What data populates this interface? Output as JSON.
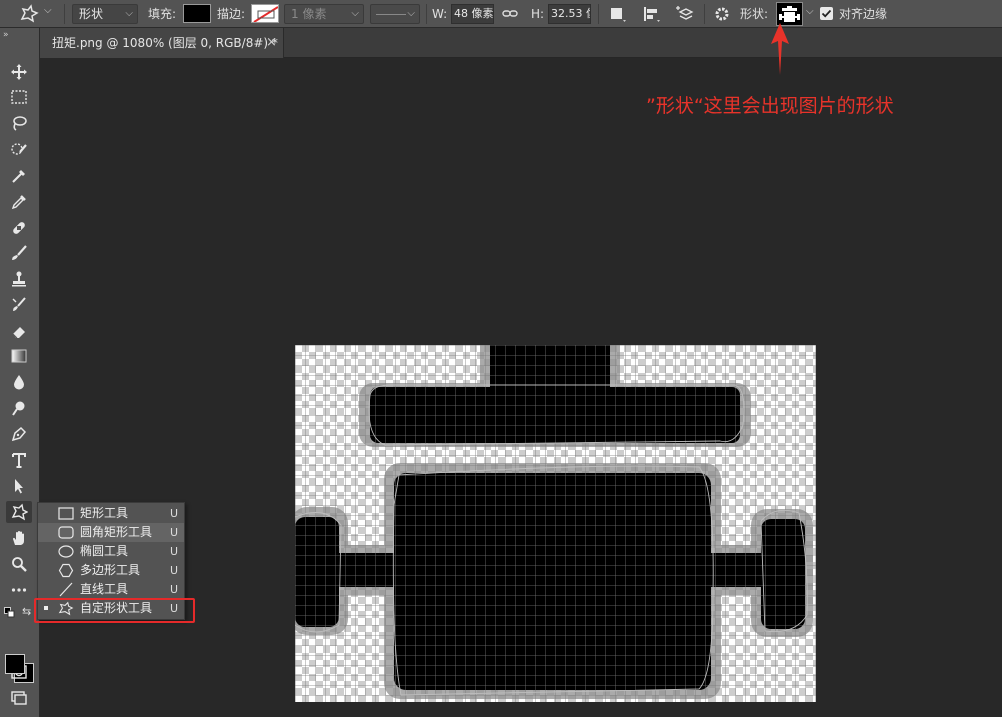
{
  "options_bar": {
    "tool_mode": "形状",
    "fill_label": "填充:",
    "fill_color": "#000000",
    "stroke_label": "描边:",
    "stroke_width": "1 像素",
    "w_label": "W:",
    "w_value": "48 像素",
    "h_label": "H:",
    "h_value": "32.53 像",
    "shape_label": "形状:",
    "align_edges_label": "对齐边缘",
    "align_edges_checked": true
  },
  "document_tab": {
    "title": "扭矩.png @ 1080% (图层 0, RGB/8#) *",
    "close_glyph": "×"
  },
  "toolbox": {
    "collapse_glyph": "»",
    "tools": [
      "move-tool",
      "marquee-tool",
      "lasso-tool",
      "quick-select-tool",
      "crop-tool",
      "eyedropper-tool",
      "healing-brush-tool",
      "brush-tool",
      "clone-stamp-tool",
      "history-brush-tool",
      "eraser-tool",
      "gradient-tool",
      "blur-tool",
      "dodge-tool",
      "pen-tool",
      "type-tool",
      "path-select-tool",
      "custom-shape-tool",
      "hand-tool",
      "zoom-tool",
      "more-tools"
    ],
    "fg_color": "#000000",
    "bg_color": "#000000"
  },
  "flyout": {
    "items": [
      {
        "label": "矩形工具",
        "key": "U",
        "icon": "rectangle-icon"
      },
      {
        "label": "圆角矩形工具",
        "key": "U",
        "icon": "rounded-rectangle-icon"
      },
      {
        "label": "椭圆工具",
        "key": "U",
        "icon": "ellipse-icon"
      },
      {
        "label": "多边形工具",
        "key": "U",
        "icon": "polygon-icon"
      },
      {
        "label": "直线工具",
        "key": "U",
        "icon": "line-icon"
      },
      {
        "label": "自定形状工具",
        "key": "U",
        "icon": "custom-shape-icon"
      }
    ],
    "highlighted_index": 1,
    "selected_index": 5
  },
  "annotation": {
    "text": "”形状“这里会出现图片的形状",
    "color": "#e8332a"
  }
}
